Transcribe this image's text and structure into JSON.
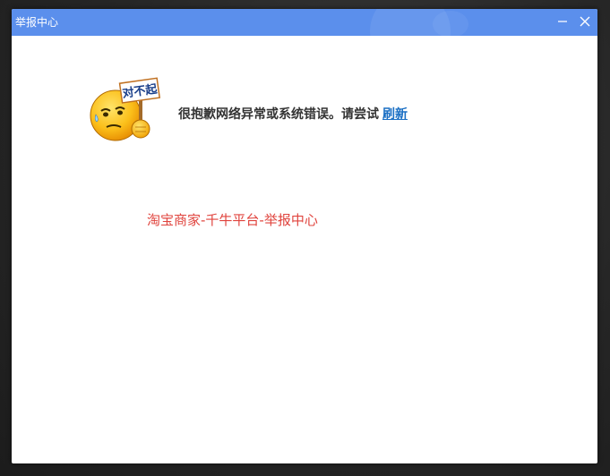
{
  "window": {
    "title": "举报中心"
  },
  "error": {
    "sign_text": "对不起",
    "message": "很抱歉网络异常或系统错误。请尝试",
    "refresh_label": "刷新"
  },
  "app_info": {
    "text": "淘宝商家-千牛平台-举报中心"
  },
  "colors": {
    "titlebar": "#5b8fec",
    "link": "#1a6fc4",
    "app_info": "#e0443e"
  }
}
